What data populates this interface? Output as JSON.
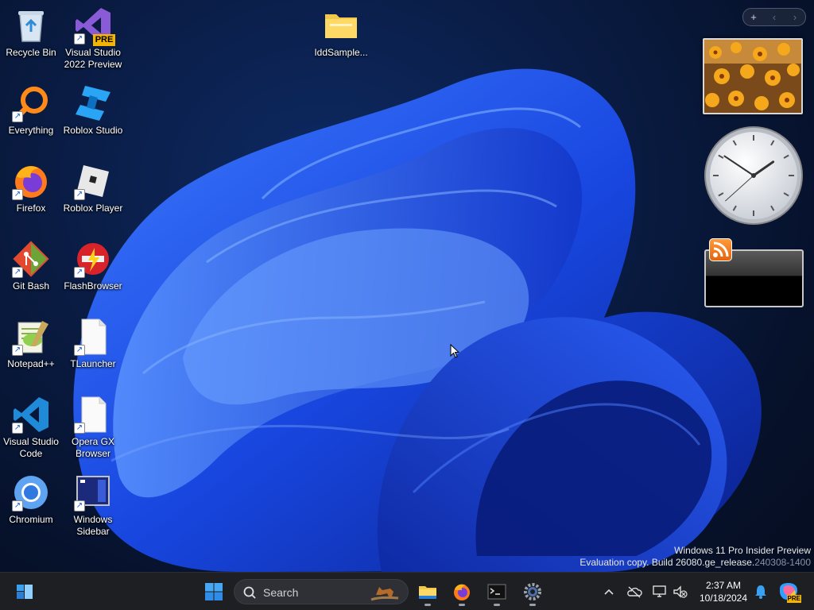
{
  "desktop": {
    "icons": [
      {
        "label": "Recycle Bin",
        "icon": "recycle-bin-icon"
      },
      {
        "label": "Visual Studio 2022 Preview",
        "icon": "visual-studio-preview-icon",
        "badge": "PRE"
      },
      {
        "label": "IddSample...",
        "icon": "folder-icon"
      },
      {
        "label": "Everything",
        "icon": "everything-search-icon"
      },
      {
        "label": "Roblox Studio",
        "icon": "roblox-studio-icon"
      },
      {
        "label": "Firefox",
        "icon": "firefox-icon"
      },
      {
        "label": "Roblox Player",
        "icon": "roblox-player-icon"
      },
      {
        "label": "Git Bash",
        "icon": "git-bash-icon"
      },
      {
        "label": "FlashBrowser",
        "icon": "flash-browser-icon"
      },
      {
        "label": "Notepad++",
        "icon": "notepad-plus-plus-icon"
      },
      {
        "label": "TLauncher",
        "icon": "blank-file-icon"
      },
      {
        "label": "Visual Studio Code",
        "icon": "vscode-icon"
      },
      {
        "label": "Opera GX Browser",
        "icon": "blank-file-icon"
      },
      {
        "label": "Chromium",
        "icon": "chromium-icon"
      },
      {
        "label": "Windows Sidebar",
        "icon": "windows-sidebar-icon"
      }
    ]
  },
  "gadgets": {
    "toolbar": {
      "add": "+",
      "prev": "‹",
      "next": "›"
    },
    "slideshow": "flowers-photo",
    "clock": {
      "hour": 1,
      "minute": 50,
      "second": 38
    },
    "feed": "rss-feed-icon"
  },
  "watermark": {
    "line1": "Windows 11 Pro Insider Preview",
    "line2_main": "Evaluation copy. Build 26080.ge_release.",
    "line2_dim": "240308-1400"
  },
  "taskbar": {
    "search_placeholder": "Search",
    "apps": [
      "widgets-icon",
      "start-icon",
      "file-explorer-icon",
      "firefox-icon",
      "terminal-icon",
      "settings-icon"
    ],
    "tray": [
      "chevron-up-icon",
      "onedrive-icon",
      "network-icon",
      "volume-muted-icon",
      "notification-bell-icon",
      "copilot-icon"
    ],
    "time": "2:37 AM",
    "date": "10/18/2024",
    "copilot_badge": "PRE"
  },
  "colors": {
    "accent": "#1a6cff",
    "taskbar": "#1e1f23",
    "desktop_bg": "#0a1c44"
  }
}
